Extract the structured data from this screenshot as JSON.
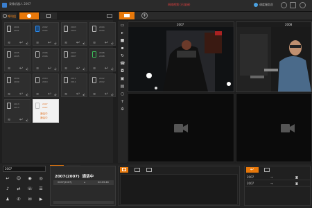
{
  "window": {
    "title": "录像机器人 2007",
    "warning": "网络视频 (已连接)",
    "user": "调度服务员"
  },
  "menubar": {
    "item1": "呼叫组",
    "item2": "通讯录"
  },
  "tiles": [
    {
      "id1": "2001",
      "id2": "2001"
    },
    {
      "id1": "2002",
      "id2": "2002"
    },
    {
      "id1": "2003",
      "id2": "2003"
    },
    {
      "id1": "2004",
      "id2": "2004"
    },
    {
      "id1": "2005",
      "id2": "2005"
    },
    {
      "id1": "2006",
      "id2": "2006"
    },
    {
      "id1": "2007",
      "id2": "2007"
    },
    {
      "id1": "2008",
      "id2": "2008"
    },
    {
      "id1": "2009",
      "id2": "2009"
    },
    {
      "id1": "2010",
      "id2": "2010"
    },
    {
      "id1": "2011",
      "id2": "2011"
    },
    {
      "id1": "2012",
      "id2": "2012"
    },
    {
      "id1": "2013",
      "id2": "2013"
    },
    {
      "id1": "2007",
      "id2": "2007",
      "state": "通话中"
    }
  ],
  "video": {
    "cell1_id": "2007",
    "cell2_id": "2008"
  },
  "dial_input": {
    "value": "2007"
  },
  "call": {
    "title": "2007(2007)",
    "status": "通话中",
    "row_number": "2007(2007)",
    "row_time": "00:03:46"
  },
  "records": {
    "row1": "2007",
    "row2": "2007"
  },
  "colors": {
    "accent": "#e8780a",
    "active_tile": "#f2f2f2"
  }
}
